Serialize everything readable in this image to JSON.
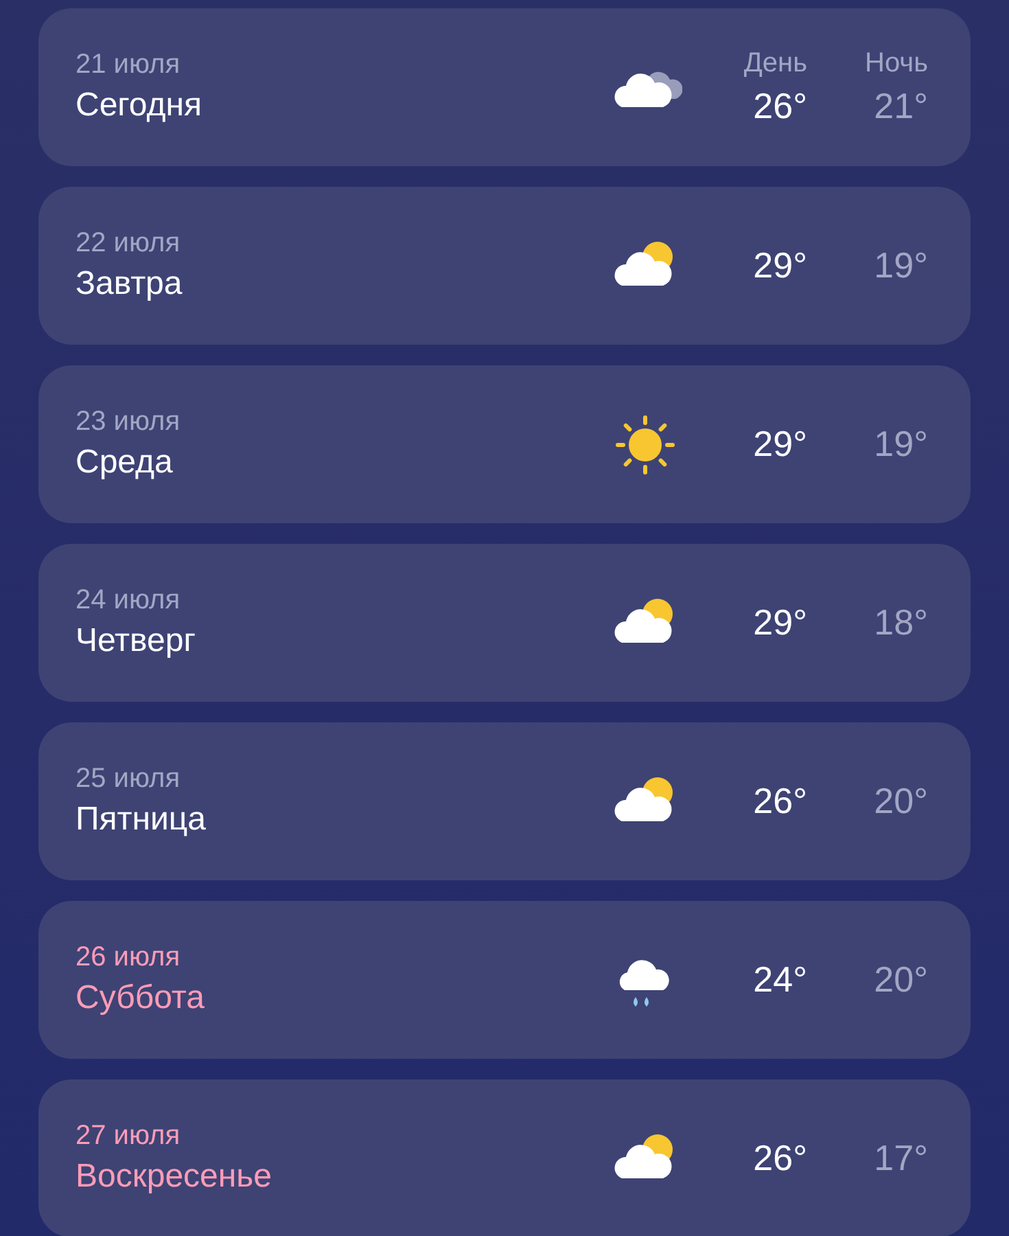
{
  "days": [
    {
      "date": "21 июля",
      "name": "Сегодня",
      "weekend": false,
      "kind": "cloudy",
      "day_label": "День",
      "night_label": "Ночь",
      "day": "26°",
      "night": "21°"
    },
    {
      "date": "22 июля",
      "name": "Завтра",
      "weekend": false,
      "kind": "partly-cloudy",
      "day": "29°",
      "night": "19°"
    },
    {
      "date": "23 июля",
      "name": "Среда",
      "weekend": false,
      "kind": "sunny",
      "day": "29°",
      "night": "19°"
    },
    {
      "date": "24 июля",
      "name": "Четверг",
      "weekend": false,
      "kind": "partly-cloudy",
      "day": "29°",
      "night": "18°"
    },
    {
      "date": "25 июля",
      "name": "Пятница",
      "weekend": false,
      "kind": "partly-cloudy",
      "day": "26°",
      "night": "20°"
    },
    {
      "date": "26 июля",
      "name": "Суббота",
      "weekend": true,
      "kind": "rain",
      "day": "24°",
      "night": "20°"
    },
    {
      "date": "27 июля",
      "name": "Воскресенье",
      "weekend": true,
      "kind": "partly-cloudy",
      "day": "26°",
      "night": "17°"
    }
  ]
}
